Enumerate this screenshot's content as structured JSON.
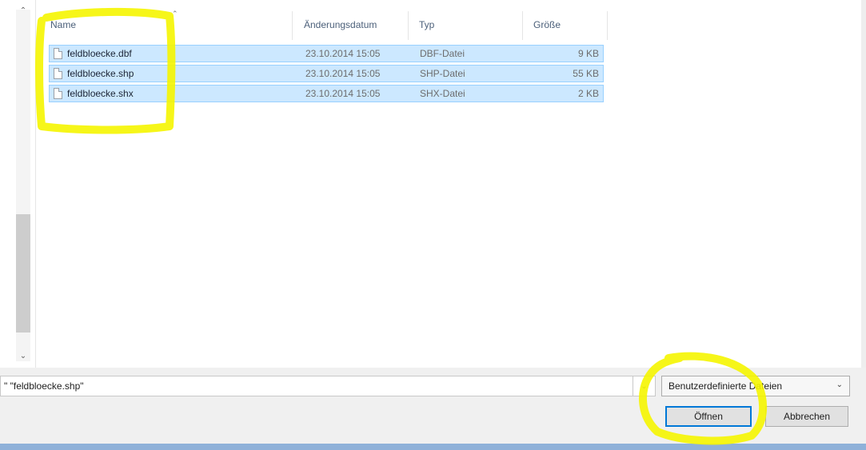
{
  "file_list": {
    "columns": {
      "name": "Name",
      "date": "Änderungsdatum",
      "type": "Typ",
      "size": "Größe"
    },
    "files": [
      {
        "name": "feldbloecke.dbf",
        "date": "23.10.2014 15:05",
        "type": "DBF-Datei",
        "size": "9 KB",
        "icon": "blank-document-icon"
      },
      {
        "name": "feldbloecke.shp",
        "date": "23.10.2014 15:05",
        "type": "SHP-Datei",
        "size": "55 KB",
        "icon": "text-document-icon"
      },
      {
        "name": "feldbloecke.shx",
        "date": "23.10.2014 15:05",
        "type": "SHX-Datei",
        "size": "2 KB",
        "icon": "text-document-icon"
      }
    ]
  },
  "filename_field": {
    "value": "\" \"feldbloecke.shp\""
  },
  "file_type_filter": {
    "selected": "Benutzerdefinierte Dateien"
  },
  "buttons": {
    "open": "Öffnen",
    "cancel": "Abbrechen"
  },
  "colors": {
    "selection_fill": "#cce8ff",
    "selection_border": "#99d1ff",
    "highlighter": "#f5f500",
    "accent": "#0078d7"
  }
}
